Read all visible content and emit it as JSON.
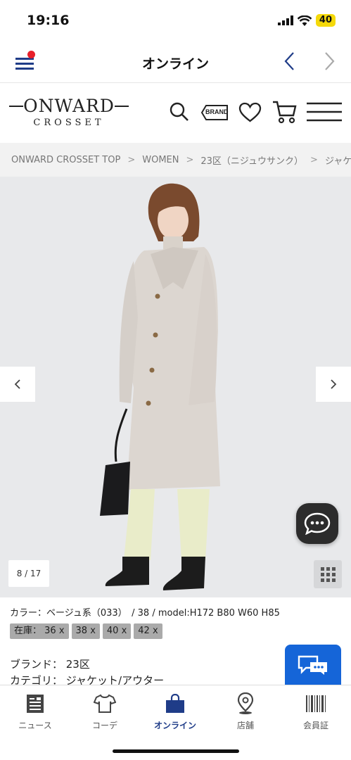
{
  "status_bar": {
    "time": "19:16",
    "battery": "40"
  },
  "app_header": {
    "title": "オンライン"
  },
  "logo": {
    "main": "ONWARD",
    "sub": "CROSSET"
  },
  "site_header": {
    "brand_icon_label": "BRAND"
  },
  "breadcrumb": [
    "ONWARD CROSSET TOP",
    "WOMEN",
    "23区（ニジュウサンク）",
    "ジャケ"
  ],
  "gallery": {
    "counter": "8 / 17"
  },
  "product": {
    "color_line": "カラー：ベージュ系（033）　/  38  /  model:H172 B80 W60 H85",
    "stock_label": "在庫：",
    "stock_items": [
      "36 x",
      "38 x",
      "40 x",
      "42 x"
    ],
    "brand_line": "ブランド： 23区",
    "category_line": "カテゴリ： ジャケット/アウター"
  },
  "tabs": [
    {
      "label": "ニュース",
      "icon": "news-icon"
    },
    {
      "label": "コーデ",
      "icon": "tshirt-icon"
    },
    {
      "label": "オンライン",
      "icon": "shopping-bag-icon"
    },
    {
      "label": "店舗",
      "icon": "map-pin-icon"
    },
    {
      "label": "会員証",
      "icon": "barcode-icon"
    }
  ],
  "colors": {
    "accent": "#1f3c88",
    "notification": "#e8202a",
    "fab": "#1565d8",
    "image_bg": "#e8e9eb"
  }
}
